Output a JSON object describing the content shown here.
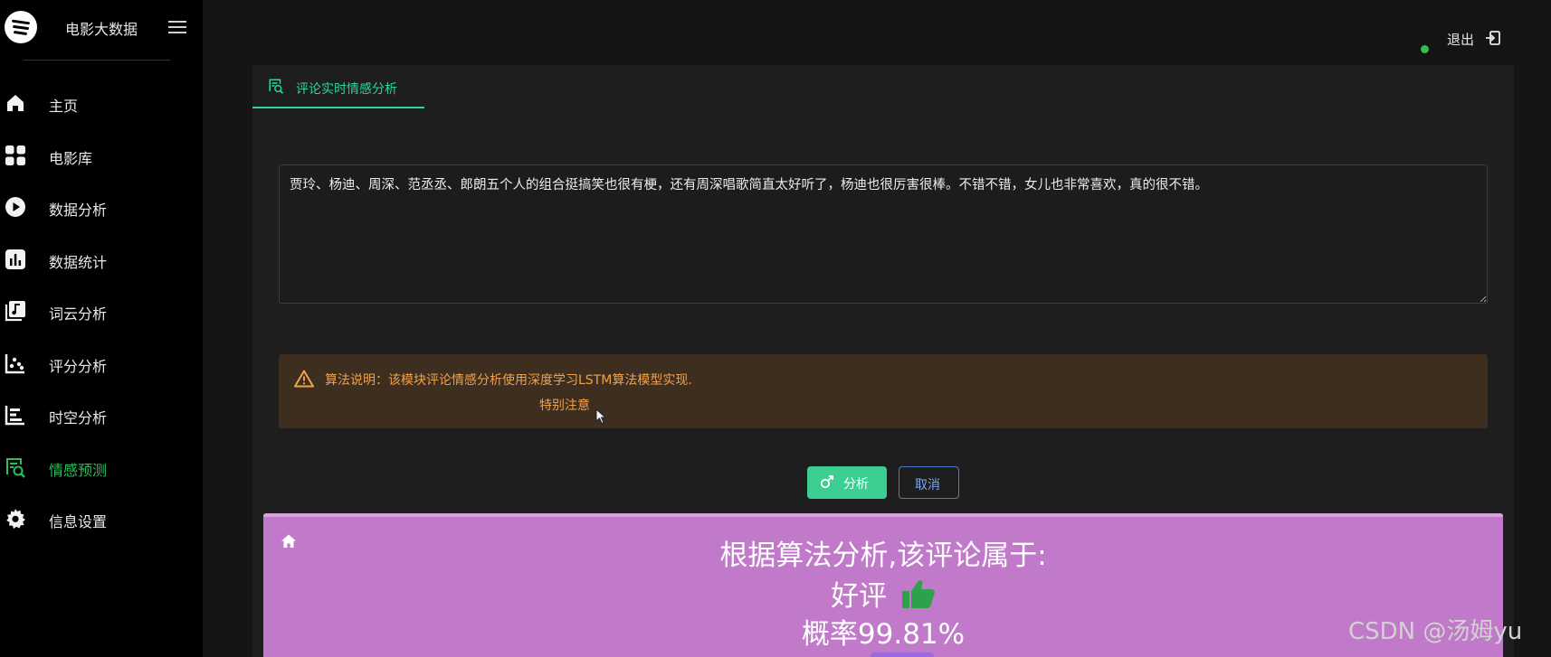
{
  "sidebar": {
    "brand_title": "电影大数据",
    "items": [
      {
        "label": "主页",
        "icon": "home-icon"
      },
      {
        "label": "电影库",
        "icon": "grid-icon"
      },
      {
        "label": "数据分析",
        "icon": "play-circle-icon"
      },
      {
        "label": "数据统计",
        "icon": "bar-chart-icon"
      },
      {
        "label": "词云分析",
        "icon": "music-book-icon"
      },
      {
        "label": "评分分析",
        "icon": "scatter-chart-icon"
      },
      {
        "label": "时空分析",
        "icon": "timeline-chart-icon"
      },
      {
        "label": "情感预测",
        "icon": "search-data-icon",
        "active": true
      },
      {
        "label": "信息设置",
        "icon": "gear-icon"
      }
    ]
  },
  "header": {
    "logout_label": "退出",
    "status_color": "#2fbf4d"
  },
  "tab": {
    "label": "评论实时情感分析"
  },
  "comment": {
    "value": "贾玲、杨迪、周深、范丞丞、郎朗五个人的组合挺搞笑也很有梗，还有周深唱歌简直太好听了，杨迪也很厉害很棒。不错不错，女儿也非常喜欢，真的很不错。"
  },
  "alert": {
    "line1": "算法说明：该模块评论情感分析使用深度学习LSTM算法模型实现.",
    "line2": "特别注意"
  },
  "buttons": {
    "analyze": "分析",
    "cancel": "取消"
  },
  "result": {
    "heading": "根据算法分析,该评论属于:",
    "label": "好评",
    "probability": "概率99.81%"
  },
  "watermark": "CSDN @汤姆yu",
  "colors": {
    "accent": "#2fd49a",
    "active_nav": "#2dbd5c",
    "result_bg": "#c07ac9",
    "alert_bg": "#3d2e1f",
    "alert_text": "#f0a24b"
  }
}
